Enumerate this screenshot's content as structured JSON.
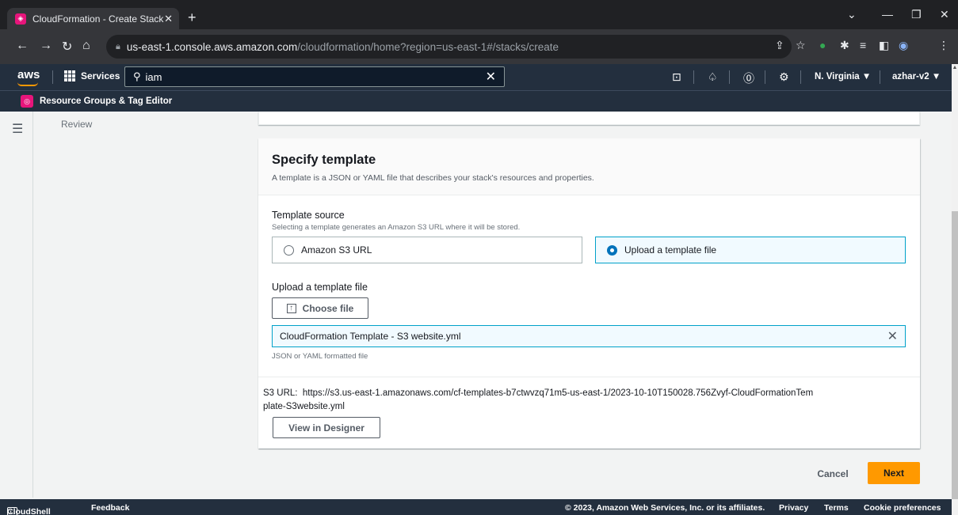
{
  "browser": {
    "tab_title": "CloudFormation - Create Stack",
    "tab_close": "✕",
    "new_tab": "+",
    "url_host": "us-east-1.console.aws.amazon.com",
    "url_path": "/cloudformation/home?region=us-east-1#/stacks/create"
  },
  "aws_nav": {
    "logo": "aws",
    "services_label": "Services",
    "search_value": "iam",
    "region": "N. Virginia ▼",
    "account": "azhar-v2 ▼"
  },
  "favorites": {
    "item": "Resource Groups & Tag Editor"
  },
  "sidebar": {
    "step_review": "Review"
  },
  "template_card": {
    "title": "Specify template",
    "description": "A template is a JSON or YAML file that describes your stack's resources and properties.",
    "source_label": "Template source",
    "source_sub": "Selecting a template generates an Amazon S3 URL where it will be stored.",
    "option_s3": "Amazon S3 URL",
    "option_upload": "Upload a template file",
    "selected_option": "Upload a template file",
    "upload_label": "Upload a template file",
    "choose_file": "Choose file",
    "file_name": "CloudFormation Template - S3 website.yml",
    "file_hint": "JSON or YAML formatted file",
    "s3_url_prefix": "S3 URL:",
    "s3_url_value": "https://s3.us-east-1.amazonaws.com/cf-templates-b7ctwvzq71m5-us-east-1/2023-10-10T150028.756Zvyf-CloudFormationTemplate-S3website.yml",
    "view_designer": "View in Designer"
  },
  "actions": {
    "cancel": "Cancel",
    "next": "Next"
  },
  "footer": {
    "cloudshell": "CloudShell",
    "feedback": "Feedback",
    "copyright": "© 2023, Amazon Web Services, Inc. or its affiliates.",
    "privacy": "Privacy",
    "terms": "Terms",
    "cookie": "Cookie preferences"
  },
  "colors": {
    "aws_nav_bg": "#232f3e",
    "primary_button": "#ff9900",
    "selected_border": "#00a1c9",
    "radio_selected": "#0073bb"
  }
}
